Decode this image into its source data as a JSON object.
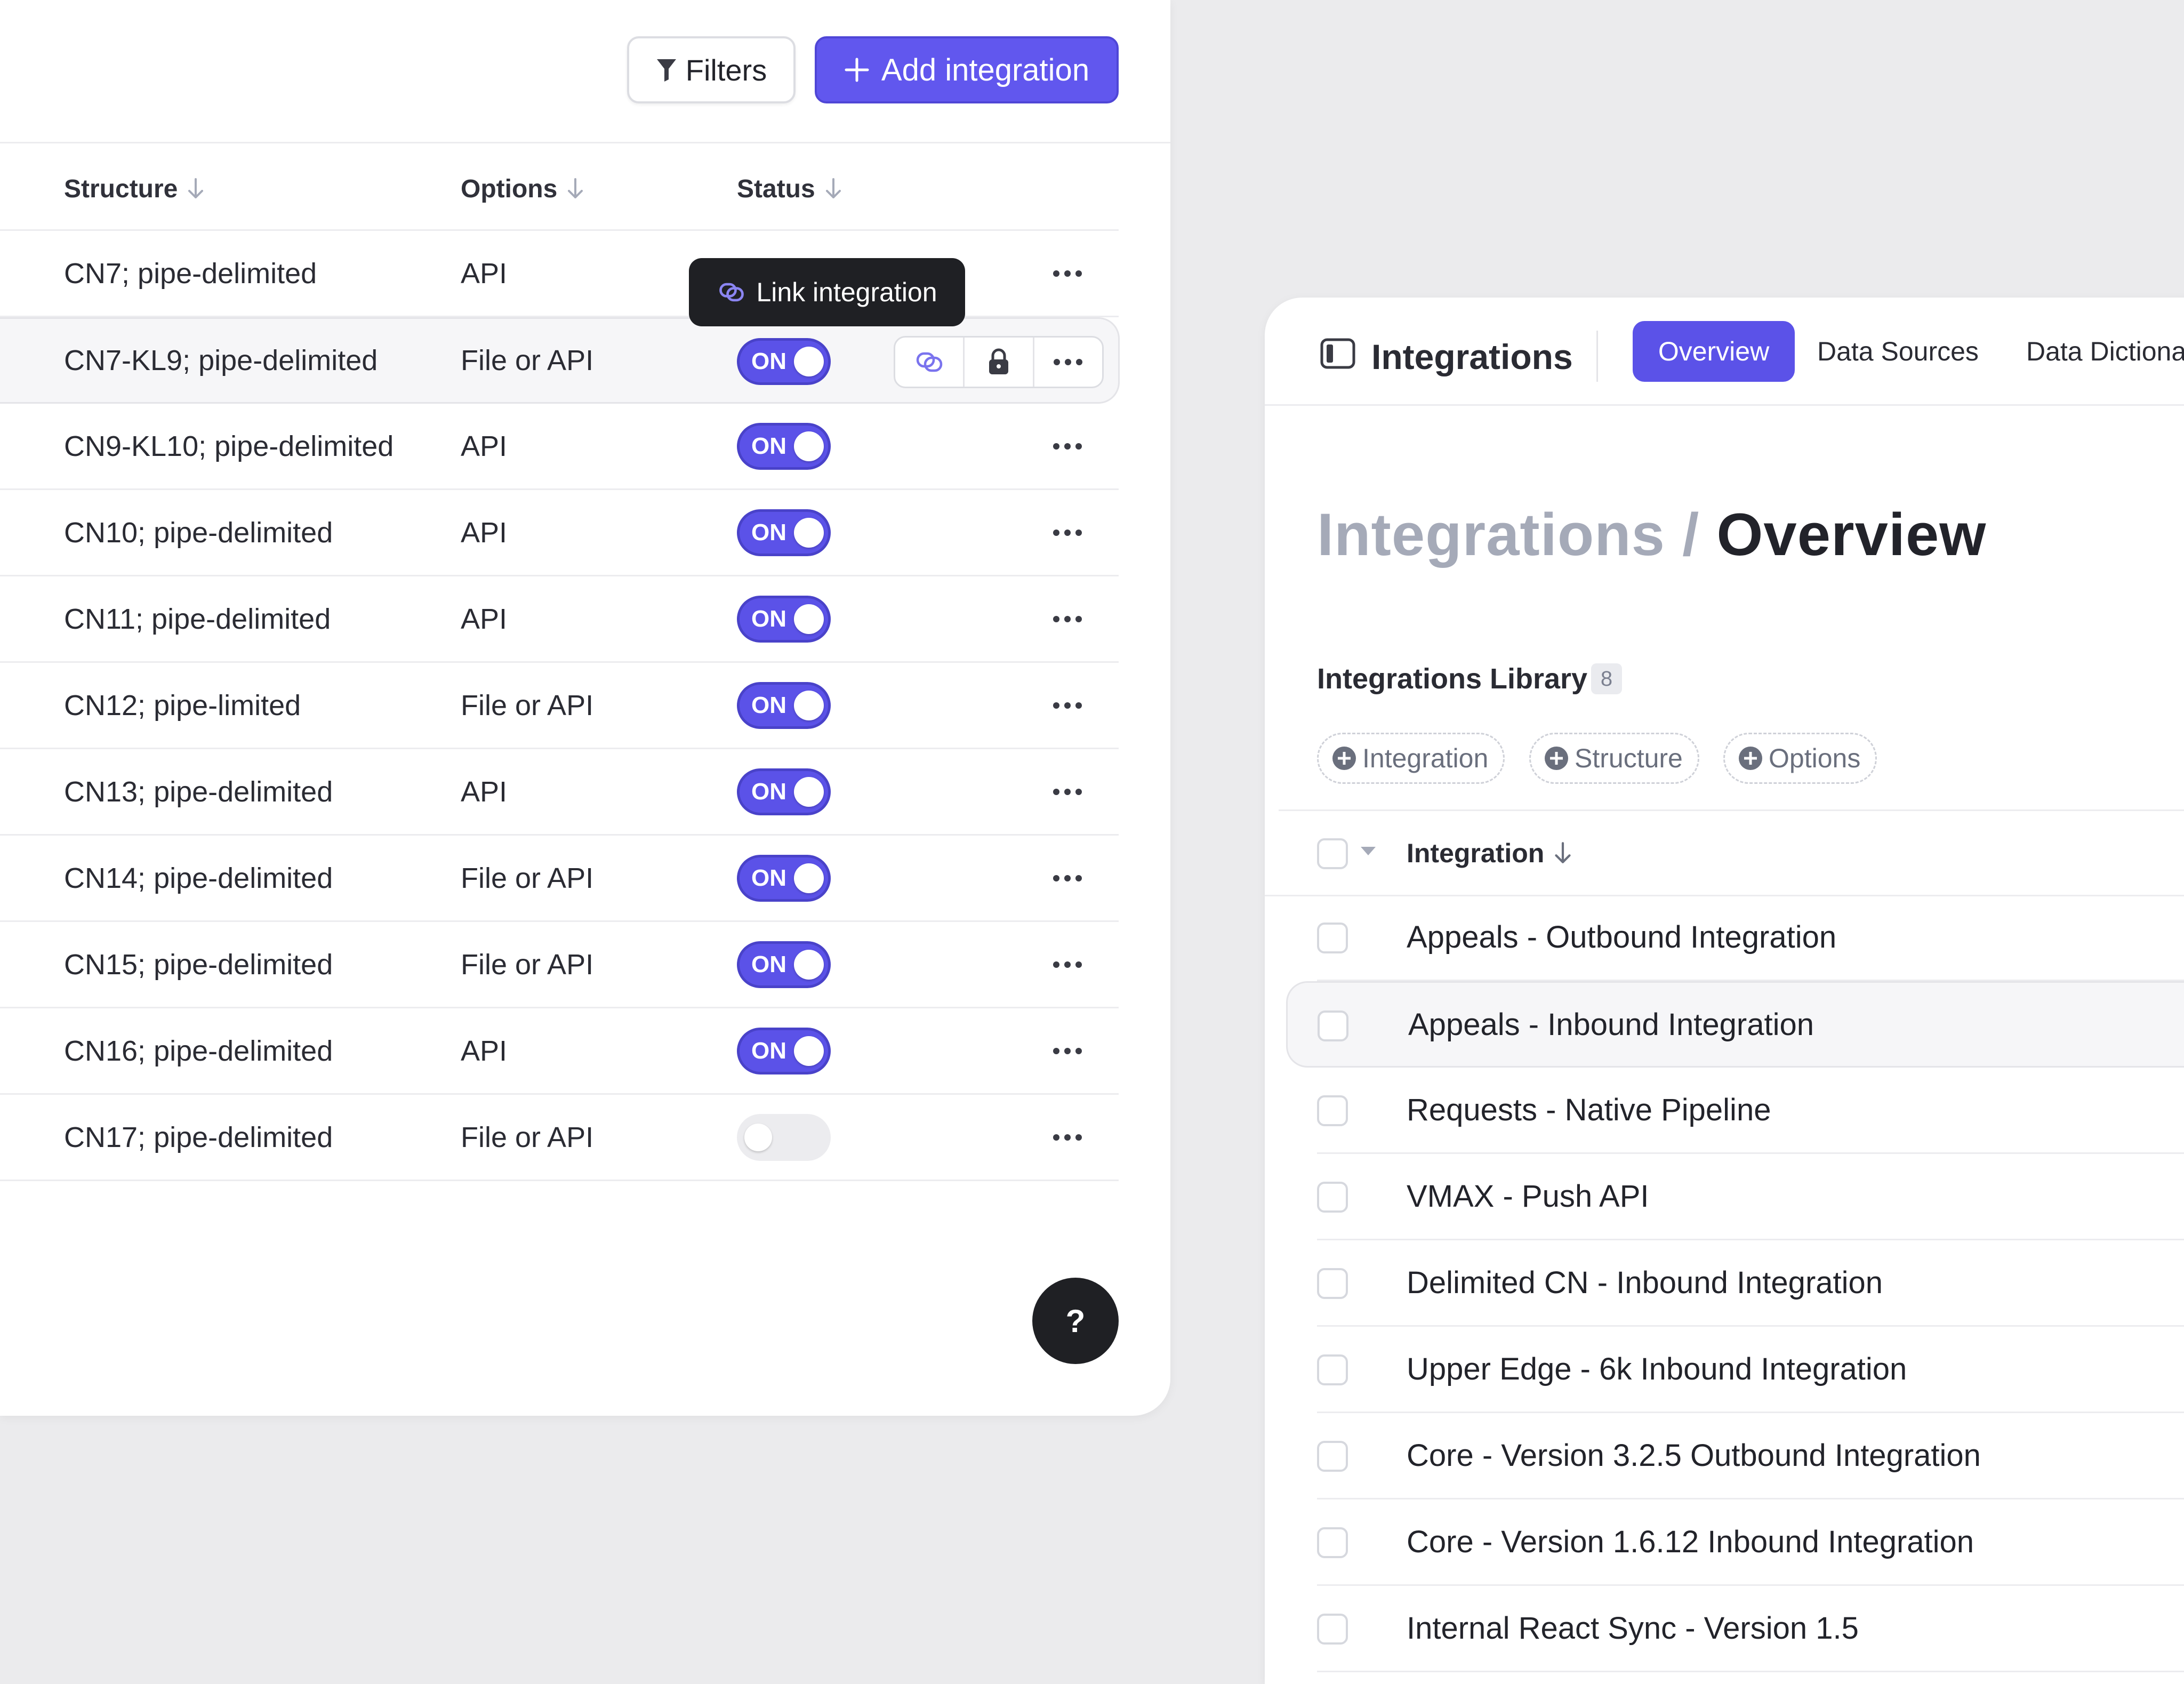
{
  "toolbar": {
    "filters_label": "Filters",
    "add_label": "Add integration"
  },
  "table": {
    "columns": [
      "Structure",
      "Options",
      "Status"
    ],
    "rows": [
      {
        "structure": "CN7; pipe-delimited",
        "options": "API",
        "status": ""
      },
      {
        "structure": "CN7-KL9; pipe-delimited",
        "options": "File or API",
        "status": "ON"
      },
      {
        "structure": "CN9-KL10; pipe-delimited",
        "options": "API",
        "status": "ON"
      },
      {
        "structure": "CN10; pipe-delimited",
        "options": "API",
        "status": "ON"
      },
      {
        "structure": "CN11; pipe-delimited",
        "options": "API",
        "status": "ON"
      },
      {
        "structure": "CN12; pipe-limited",
        "options": "File or API",
        "status": "ON"
      },
      {
        "structure": "CN13; pipe-delimited",
        "options": "API",
        "status": "ON"
      },
      {
        "structure": "CN14; pipe-delimited",
        "options": "File or API",
        "status": "ON"
      },
      {
        "structure": "CN15; pipe-delimited",
        "options": "File or API",
        "status": "ON"
      },
      {
        "structure": "CN16; pipe-delimited",
        "options": "API",
        "status": "ON"
      },
      {
        "structure": "CN17; pipe-delimited",
        "options": "File or API",
        "status": "OFF"
      }
    ]
  },
  "tooltip": {
    "label": "Link integration"
  },
  "help": {
    "label": "?"
  },
  "integrations_panel": {
    "title": "Integrations",
    "tabs": [
      "Overview",
      "Data Sources",
      "Data Dictiona"
    ],
    "active_tab": "Overview",
    "breadcrumb": {
      "parent": "Integrations",
      "separator": "/",
      "current": "Overview"
    },
    "library": {
      "title": "Integrations Library",
      "count": "8"
    },
    "filter_chips": [
      "Integration",
      "Structure",
      "Options"
    ],
    "column_header": "Integration",
    "items": [
      "Appeals - Outbound Integration",
      "Appeals - Inbound Integration",
      "Requests - Native Pipeline",
      "VMAX - Push API",
      "Delimited CN - Inbound Integration",
      "Upper Edge - 6k Inbound Integration",
      "Core - Version 3.2.5 Outbound Integration",
      "Core - Version 1.6.12 Inbound Integration",
      "Internal React Sync - Version 1.5"
    ]
  },
  "colors": {
    "accent": "#5b52e8",
    "accent_dark": "#4942c9",
    "toggle_off": "#ececef",
    "tooltip_bg": "#1f2024",
    "background": "#ebebed"
  }
}
